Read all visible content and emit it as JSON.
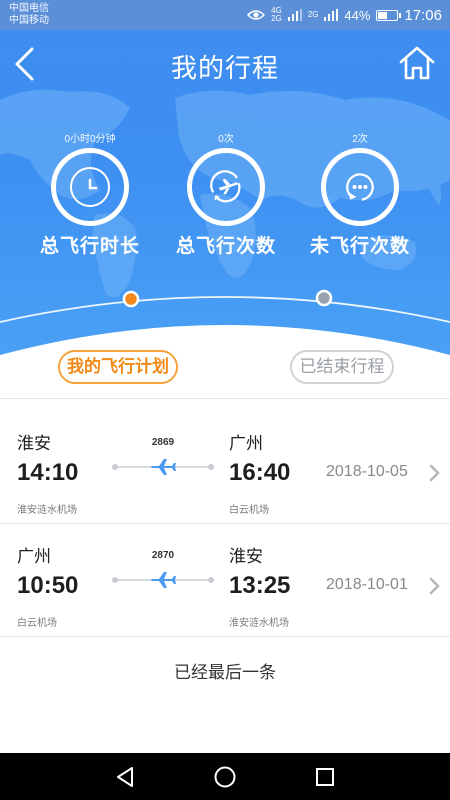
{
  "status_bar": {
    "carrier_1": "中国电信",
    "carrier_2": "中国移动",
    "network_1": "4G",
    "network_2": "2G",
    "network_3": "2G",
    "battery": "44%",
    "battery_level": 0.44,
    "time": "17:06"
  },
  "header": {
    "title": "我的行程",
    "back_icon": "chevron-left-icon",
    "home_icon": "home-icon"
  },
  "stats": [
    {
      "value": "0小时0分钟",
      "label": "总飞行时长",
      "icon": "clock-icon"
    },
    {
      "value": "0次",
      "label": "总飞行次数",
      "icon": "plane-circle-icon"
    },
    {
      "value": "2次",
      "label": "未飞行次数",
      "icon": "pending-icon"
    }
  ],
  "tabs": {
    "active": "我的飞行计划",
    "inactive": "已结束行程"
  },
  "flights": [
    {
      "from_city": "淮安",
      "from_time": "14:10",
      "from_airport": "淮安涟水机场",
      "flight_no": "2869",
      "to_city": "广州",
      "to_time": "16:40",
      "to_airport": "白云机场",
      "date": "2018-10-05"
    },
    {
      "from_city": "广州",
      "from_time": "10:50",
      "from_airport": "白云机场",
      "flight_no": "2870",
      "to_city": "淮安",
      "to_time": "13:25",
      "to_airport": "淮安涟水机场",
      "date": "2018-10-01"
    }
  ],
  "list_end": "已经最后一条",
  "colors": {
    "header_blue": "#3d8ff2",
    "accent_orange": "#f08a16",
    "plane_blue": "#4a9af0"
  }
}
